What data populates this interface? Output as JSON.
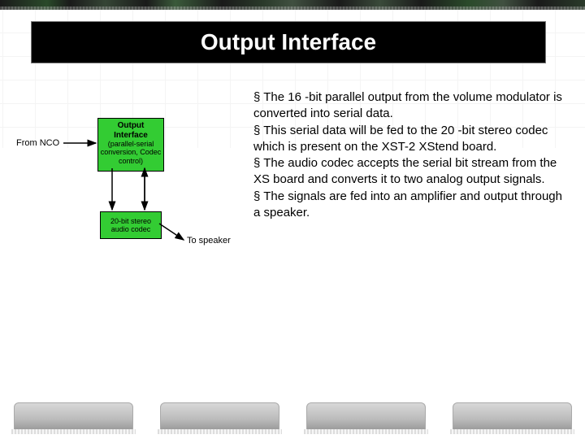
{
  "title": "Output Interface",
  "diagram": {
    "from_label": "From NCO",
    "box1_title": "Output Interface",
    "box1_sub": "(parallel-serial conversion, Codec control)",
    "box2_label": "20-bit stereo audio codec",
    "to_label": "To speaker"
  },
  "bullets": {
    "b1": "§  The 16 -bit parallel output from the volume modulator is converted into serial data.",
    "b2": "§  This serial data will be fed to the 20 -bit stereo codec which is present on the XST-2 XStend board.",
    "b3": "§  The audio codec accepts the serial bit stream from the XS board and converts it to two analog output signals.",
    "b4": "§  The signals are fed into an amplifier and output through a speaker."
  }
}
